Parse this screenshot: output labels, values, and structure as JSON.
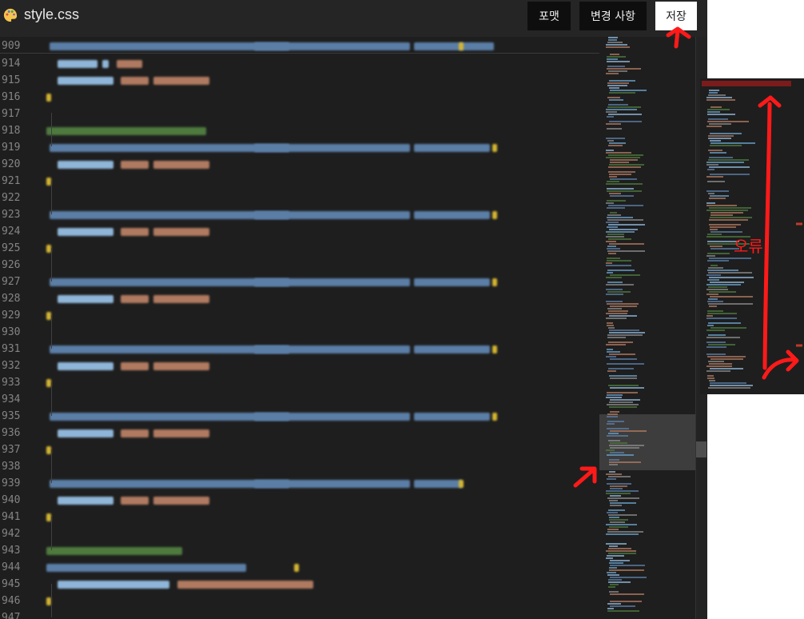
{
  "app": {
    "file_title": "style.css",
    "icon": "palette-icon"
  },
  "toolbar": {
    "format_label": "포맷",
    "changes_label": "변경 사항",
    "save_label": "저장"
  },
  "editor": {
    "line_numbers": [
      "909",
      "914",
      "915",
      "916",
      "917",
      "918",
      "919",
      "920",
      "921",
      "922",
      "923",
      "924",
      "925",
      "926",
      "927",
      "928",
      "929",
      "930",
      "931",
      "932",
      "933",
      "934",
      "935",
      "936",
      "937",
      "938",
      "939",
      "940",
      "941",
      "942",
      "943",
      "944",
      "945",
      "946",
      "947"
    ],
    "code_note": "code text is blurred / unreadable in screenshot"
  },
  "annotation": {
    "error_label": "오류",
    "color": "#ff1a1a"
  },
  "colors": {
    "editor_bg": "#1e1e1e",
    "selector_blue": "#5b7ea6",
    "property_blue": "#8fb6d8",
    "value_orange": "#b07a60",
    "comment_green": "#4e7a3e",
    "brace_yellow": "#d4b531"
  }
}
